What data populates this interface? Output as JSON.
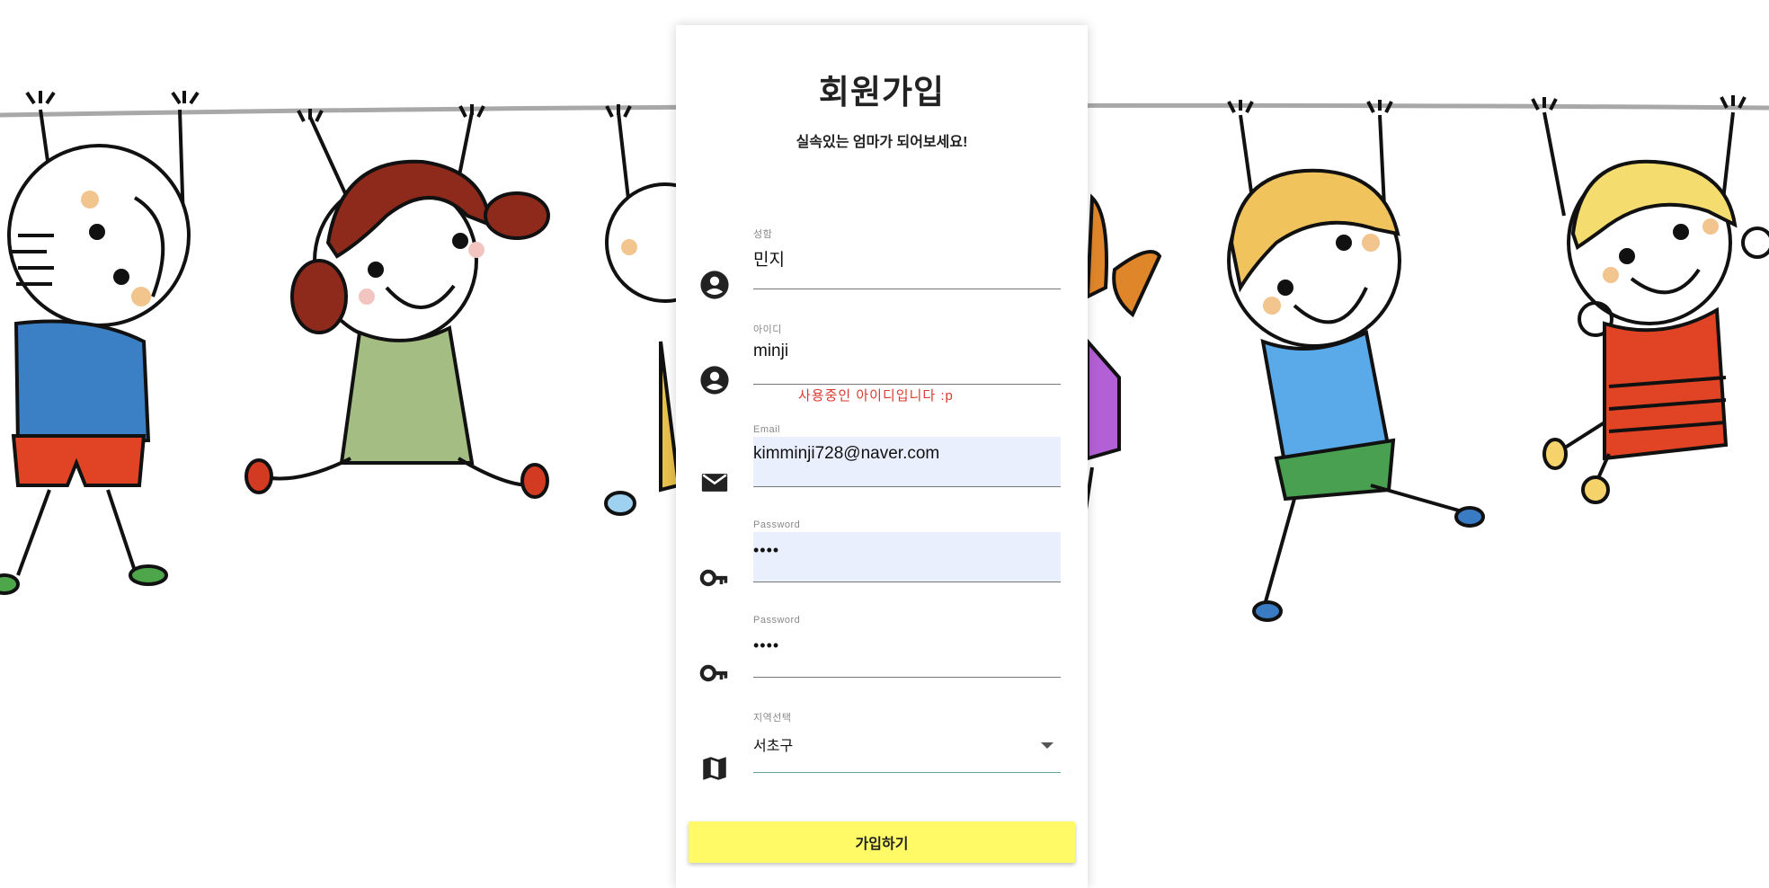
{
  "form": {
    "title": "회원가입",
    "subtitle": "실속있는 엄마가 되어보세요!",
    "fields": [
      {
        "label": "성함",
        "value": "민지",
        "icon": "person-icon"
      },
      {
        "label": "아이디",
        "value": "minji",
        "icon": "person-icon",
        "error": "사용중인 아이디입니다 :p"
      },
      {
        "label": "Email",
        "value": "kimminji728@naver.com",
        "icon": "mail-icon"
      },
      {
        "label": "Password",
        "value": "••••",
        "icon": "key-icon"
      },
      {
        "label": "Password",
        "value": "••••",
        "icon": "key-icon"
      },
      {
        "label": "지역선택",
        "value": "서초구",
        "icon": "map-icon"
      }
    ],
    "submit_label": "가입하기"
  },
  "colors": {
    "submit_bg": "#fffa66",
    "error_text": "#d93a2f",
    "autofill_bg": "#e9effd",
    "select_underline": "#5fa58a"
  },
  "background": {
    "description_icon": "hanging-kids-illustration"
  }
}
